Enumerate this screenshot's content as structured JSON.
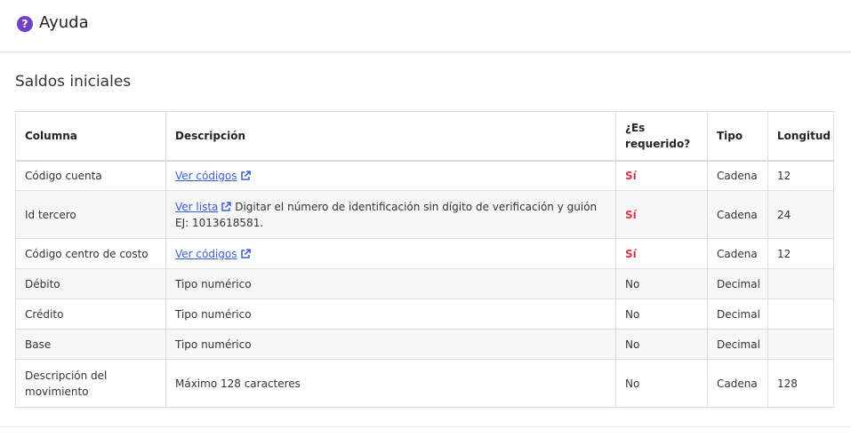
{
  "header": {
    "title": "Ayuda",
    "icon": "question-circle-icon",
    "icon_glyph": "?",
    "icon_color": "#6f42c1"
  },
  "section": {
    "title": "Saldos iniciales"
  },
  "table": {
    "headers": {
      "columna": "Columna",
      "descripcion": "Descripción",
      "requerido_line1": "¿Es",
      "requerido_line2": "requerido?",
      "tipo": "Tipo",
      "longitud": "Longitud"
    },
    "rows": [
      {
        "columna": "Código cuenta",
        "link": "Ver códigos",
        "descripcion": "",
        "requerido": "Sí",
        "tipo": "Cadena",
        "longitud": "12"
      },
      {
        "columna": "Id tercero",
        "link": "Ver lista",
        "descripcion": "Digitar el número de identificación sin dígito de verificación y guión EJ: 1013618581.",
        "requerido": "Sí",
        "tipo": "Cadena",
        "longitud": "24"
      },
      {
        "columna": "Código centro de costo",
        "link": "Ver códigos",
        "descripcion": "",
        "requerido": "Sí",
        "tipo": "Cadena",
        "longitud": "12"
      },
      {
        "columna": "Débito",
        "descripcion": "Tipo numérico",
        "requerido": "No",
        "tipo": "Decimal",
        "longitud": ""
      },
      {
        "columna": "Crédito",
        "descripcion": "Tipo numérico",
        "requerido": "No",
        "tipo": "Decimal",
        "longitud": ""
      },
      {
        "columna": "Base",
        "descripcion": "Tipo numérico",
        "requerido": "No",
        "tipo": "Decimal",
        "longitud": ""
      },
      {
        "columna": "Descripción del movimiento",
        "descripcion": "Máximo 128 caracteres",
        "requerido": "No",
        "tipo": "Cadena",
        "longitud": "128"
      }
    ]
  },
  "colors": {
    "link": "#3b5bdb",
    "required_yes": "#dc3545"
  }
}
